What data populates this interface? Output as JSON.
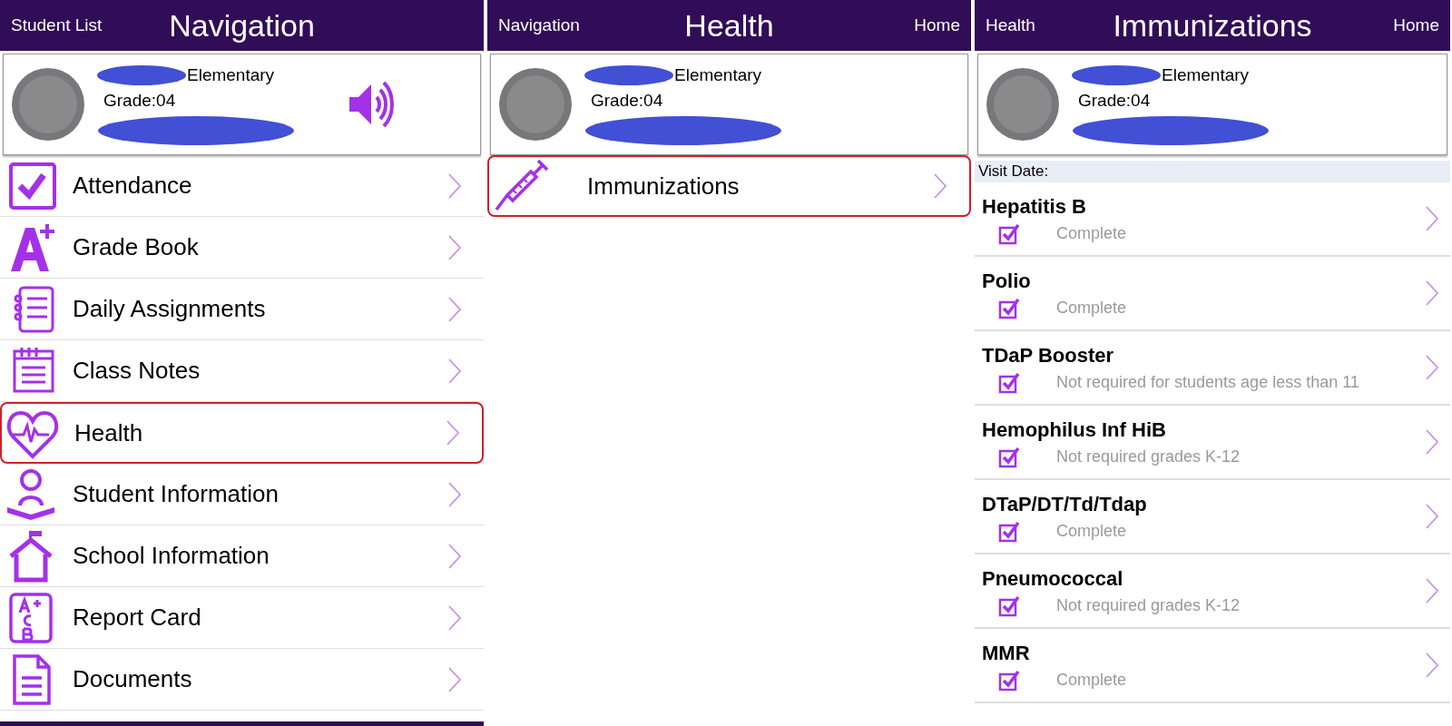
{
  "screens": [
    {
      "header": {
        "back": "Student List",
        "title": "Navigation"
      },
      "student": {
        "school": "Elementary",
        "grade": "Grade:04",
        "audio": true
      },
      "items": [
        {
          "label": "Attendance",
          "selected": false
        },
        {
          "label": "Grade Book",
          "selected": false
        },
        {
          "label": "Daily Assignments",
          "selected": false
        },
        {
          "label": "Class Notes",
          "selected": false
        },
        {
          "label": "Health",
          "selected": true
        },
        {
          "label": "Student Information",
          "selected": false
        },
        {
          "label": "School Information",
          "selected": false
        },
        {
          "label": "Report Card",
          "selected": false
        },
        {
          "label": "Documents",
          "selected": false
        }
      ]
    },
    {
      "header": {
        "back": "Navigation",
        "title": "Health",
        "home": "Home"
      },
      "student": {
        "school": "Elementary",
        "grade": "Grade:04",
        "audio": false
      },
      "items": [
        {
          "label": "Immunizations",
          "selected": true
        }
      ]
    },
    {
      "header": {
        "back": "Health",
        "title": "Immunizations",
        "home": "Home"
      },
      "student": {
        "school": "Elementary",
        "grade": "Grade:04",
        "audio": false
      },
      "visit_date": "Visit Date:",
      "immunizations": [
        {
          "name": "Hepatitis B",
          "checked": true,
          "status": "Complete"
        },
        {
          "name": "Polio",
          "checked": true,
          "status": "Complete"
        },
        {
          "name": "TDaP Booster",
          "checked": true,
          "status": "Not required for students age less than 11"
        },
        {
          "name": "Hemophilus Inf HiB",
          "checked": true,
          "status": "Not required grades K-12"
        },
        {
          "name": "DTaP/DT/Td/Tdap",
          "checked": true,
          "status": "Complete"
        },
        {
          "name": "Pneumococcal",
          "checked": true,
          "status": "Not required grades K-12"
        },
        {
          "name": "MMR",
          "checked": true,
          "status": "Complete"
        }
      ]
    }
  ]
}
